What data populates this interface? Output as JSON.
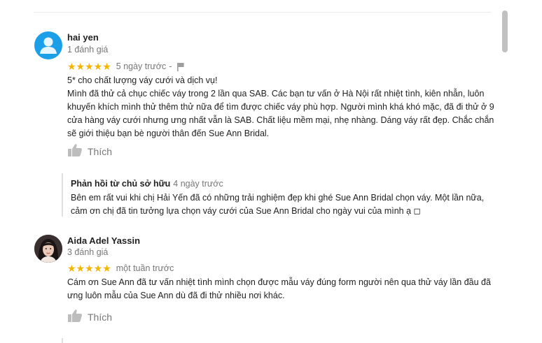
{
  "reviews": [
    {
      "name": "hai yen",
      "review_count": "1 đánh giá",
      "stars": "★★★★★",
      "rating": 5,
      "time": "5 ngày trước",
      "separator": "-",
      "lines": [
        "5* cho chất lượng váy cưới và dịch vụ!",
        "Mình đã thử cả chục chiếc váy trong 2 lần qua SAB. Các bạn tư vấn ở Hà Nội rất nhiệt tình, kiên nhẫn, luôn khuyến khích mình thử thêm thử nữa để tìm được chiếc váy phù hợp. Người mình khá khó mặc, đã đi thử ở 9 cửa hàng váy cưới nhưng ưng nhất vẫn là SAB. Chất liệu mềm mại, nhẹ nhàng. Dáng váy rất đẹp. Chắc chắn sẽ giới thiệu bạn bè người thân đến Sue Ann Bridal."
      ],
      "like_label": "Thích",
      "owner_reply": {
        "title": "Phản hồi từ chủ sở hữu",
        "time": "4 ngày trước",
        "text": "Bên em rất vui khi chị Hải Yến đã có những trải nghiệm đẹp khi ghé Sue Ann Bridal chọn váy. Một lần nữa, cảm ơn chị đã tin tưởng lựa chọn váy cưới của Sue Ann Bridal cho ngày vui của mình ạ ◻"
      }
    },
    {
      "name": "Aida Adel Yassin",
      "review_count": "3 đánh giá",
      "stars": "★★★★★",
      "rating": 5,
      "time": "một tuần trước",
      "lines": [
        "Cám ơn Sue Ann đã tư vấn nhiệt tình mình chọn được mẫu váy đúng form người nên qua thử váy lần đầu đã ưng luôn mẫu của Sue Ann dù đã đi thử nhiều nơi khác."
      ],
      "like_label": "Thích"
    }
  ],
  "icons": {
    "star": "star-icon",
    "flag": "flag-icon",
    "like": "thumbs-up-icon",
    "avatar_default": "person-icon"
  },
  "colors": {
    "star": "#f4b400",
    "muted": "#777777",
    "text": "#222222",
    "avatar_blue": "#1a9fe8",
    "reply_border": "#e0e0e0",
    "scroll_thumb": "#c1c1c1"
  }
}
